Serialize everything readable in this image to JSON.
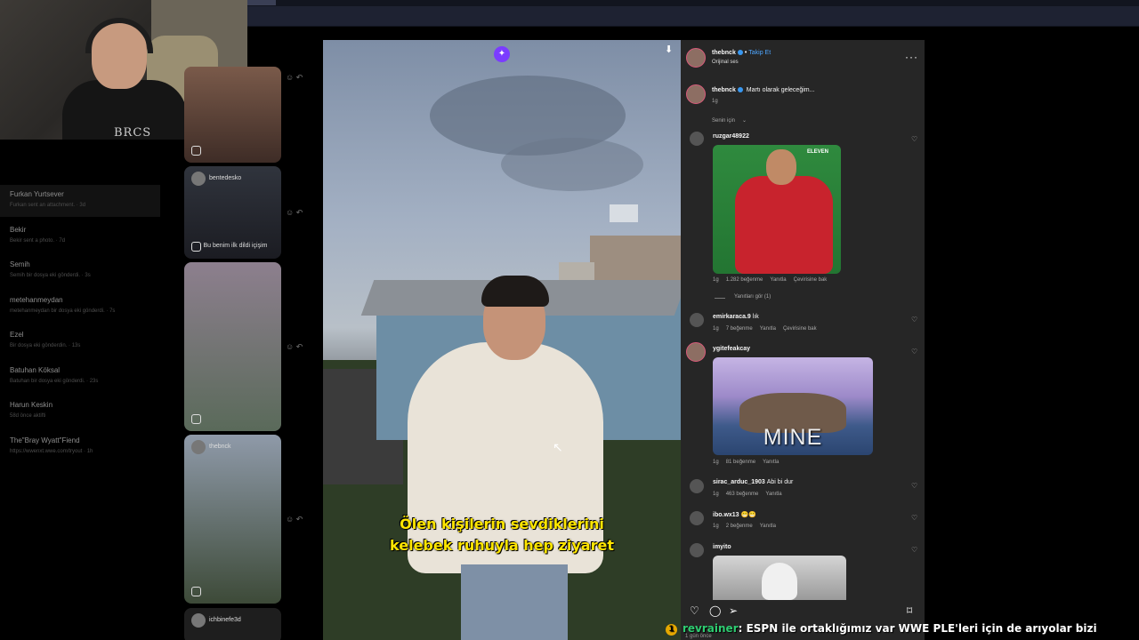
{
  "webcam": {
    "shirt_text": "BRCS"
  },
  "dm_list": [
    {
      "name": "Furkan Yurtsever",
      "sub": "Furkan sent an attachment. · 3d",
      "active": true
    },
    {
      "name": "Bekir",
      "sub": "Bekir sent a photo. · 7d",
      "active": false
    },
    {
      "name": "Semih",
      "sub": "Semih bir dosya eki gönderdi. · 3s",
      "active": false
    },
    {
      "name": "metehanmeydan",
      "sub": "metehanmeydan bir dosya eki gönderdi. · 7s",
      "active": false
    },
    {
      "name": "Ezel",
      "sub": "Bir dosya eki gönderdin. · 13s",
      "active": false
    },
    {
      "name": "Batuhan Köksal",
      "sub": "Batuhan bir dosya eki gönderdi. · 23s",
      "active": false
    },
    {
      "name": "Harun Keskin",
      "sub": "58d önce aktifti",
      "active": false
    },
    {
      "name": "The\"Bray Wyatt\"Fiend",
      "sub": "https://wwenxt.wwe.com/tryout · 1h",
      "active": false
    }
  ],
  "reels": {
    "reel2_user": "bentedesko",
    "reel2_caption": "Bu benim ilk dildi içişim",
    "reel4_user": "thebnck",
    "reel5_user": "ichbinefe3d"
  },
  "video": {
    "subtitle_line1": "Ölen kişilerin sevdiklerini",
    "subtitle_line2": "kelebek ruhuyla hep ziyaret"
  },
  "panel": {
    "header_user": "thebnck",
    "follow_label": "Takip Et",
    "audio_label": "Orijinal ses",
    "caption_user": "thebnck",
    "caption_text": "Martı olarak geleceğim...",
    "caption_time": "1g",
    "sort_label": "Senin için",
    "comments": [
      {
        "user": "ruzgar48922",
        "text": "",
        "time": "1g",
        "likes": "1.282 beğenme",
        "reply": "Yanıtla",
        "translate": "Çevirisine bak"
      },
      {
        "user": "emirkaraca.9",
        "text": "lık",
        "time": "1g",
        "likes": "7 beğenme",
        "reply": "Yanıtla",
        "translate": "Çevirisine bak"
      },
      {
        "user": "ygitefeakcay",
        "text": "",
        "time": "1g",
        "likes": "81 beğenme",
        "reply": "Yanıtla"
      },
      {
        "user": "sirac_arduc_1903",
        "text": "Abi bi dur",
        "time": "1g",
        "likes": "463 beğenme",
        "reply": "Yanıtla"
      },
      {
        "user": "ibo.wx13",
        "text": "😁😁",
        "time": "1g",
        "likes": "2 beğenme",
        "reply": "Yanıtla"
      },
      {
        "user": "imyito",
        "text": ""
      }
    ],
    "view_replies": "Yanıtları gör (1)",
    "gif1_logo": "ELEVEN",
    "gif2_text": "MINE",
    "footer_time": "1 gün önce"
  },
  "chat": {
    "user": "revrainer",
    "message": ": ESPN ile ortaklığımız var WWE PLE'leri için de arıyolar bizi"
  }
}
